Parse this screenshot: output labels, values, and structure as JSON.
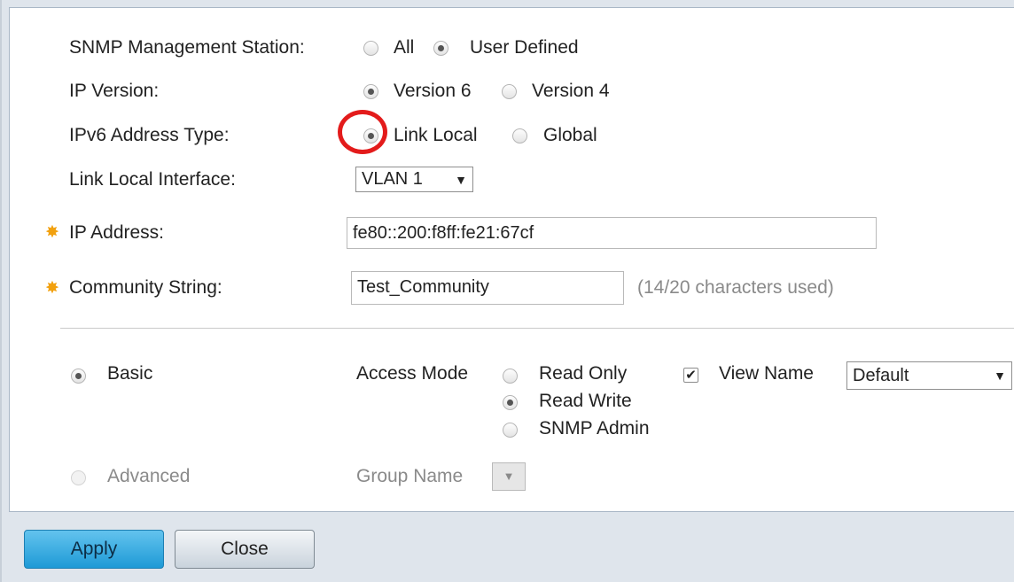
{
  "snmp_station": {
    "label": "SNMP Management Station:",
    "options": [
      {
        "label": "All",
        "selected": false
      },
      {
        "label": "User Defined",
        "selected": true
      }
    ]
  },
  "ip_version": {
    "label": "IP Version:",
    "options": [
      {
        "label": "Version 6",
        "selected": true
      },
      {
        "label": "Version 4",
        "selected": false
      }
    ]
  },
  "ipv6_address_type": {
    "label": "IPv6 Address Type:",
    "options": [
      {
        "label": "Link Local",
        "selected": true
      },
      {
        "label": "Global",
        "selected": false
      }
    ]
  },
  "link_local_interface": {
    "label": "Link Local Interface:",
    "value": "VLAN 1"
  },
  "ip_address": {
    "label": "IP Address:",
    "value": "fe80::200:f8ff:fe21:67cf"
  },
  "community_string": {
    "label": "Community String:",
    "value": "Test_Community",
    "hint": "(14/20 characters used)"
  },
  "basic": {
    "label": "Basic",
    "selected": true,
    "access_mode_label": "Access Mode",
    "access_modes": [
      {
        "label": "Read Only",
        "selected": false
      },
      {
        "label": "Read Write",
        "selected": true
      },
      {
        "label": "SNMP Admin",
        "selected": false
      }
    ],
    "view_name_label": "View Name",
    "view_name_checked": true,
    "view_name_value": "Default"
  },
  "advanced": {
    "label": "Advanced",
    "selected": false,
    "group_name_label": "Group Name"
  },
  "buttons": {
    "apply": "Apply",
    "close": "Close"
  },
  "colors": {
    "required_star": "#f2a10f",
    "annotation": "#e31b1b",
    "apply_button": "#1e9ad6"
  }
}
